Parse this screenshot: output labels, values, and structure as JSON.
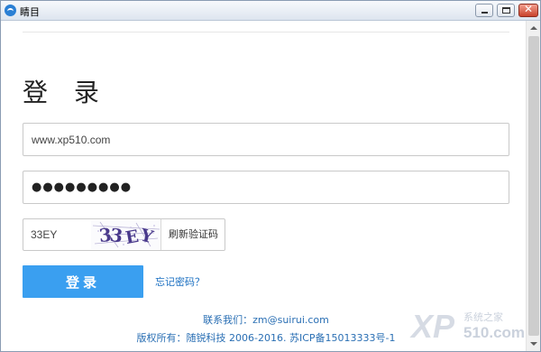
{
  "window": {
    "title": "睛目",
    "icon": "app-logo-icon",
    "controls": {
      "minimize": "minimize-icon",
      "maximize": "maximize-icon",
      "close": "✕"
    }
  },
  "login": {
    "heading": "登 录",
    "username_value": "www.xp510.com",
    "password_mask": "●●●●●●●●●",
    "captcha_value": "33EY",
    "captcha_image_text": "33EY",
    "refresh_captcha_label": "刷新验证码",
    "submit_label": "登录",
    "forgot_password_label": "忘记密码？",
    "accent_color": "#3a9ff0"
  },
  "footer": {
    "contact": "联系我们：zm@suirui.com",
    "copyright": "版权所有：随锐科技 2006-2016. 苏ICP备15013333号-1"
  },
  "watermark": {
    "logo_text": "XP",
    "site_name": "系统之家",
    "domain": "510.com"
  }
}
